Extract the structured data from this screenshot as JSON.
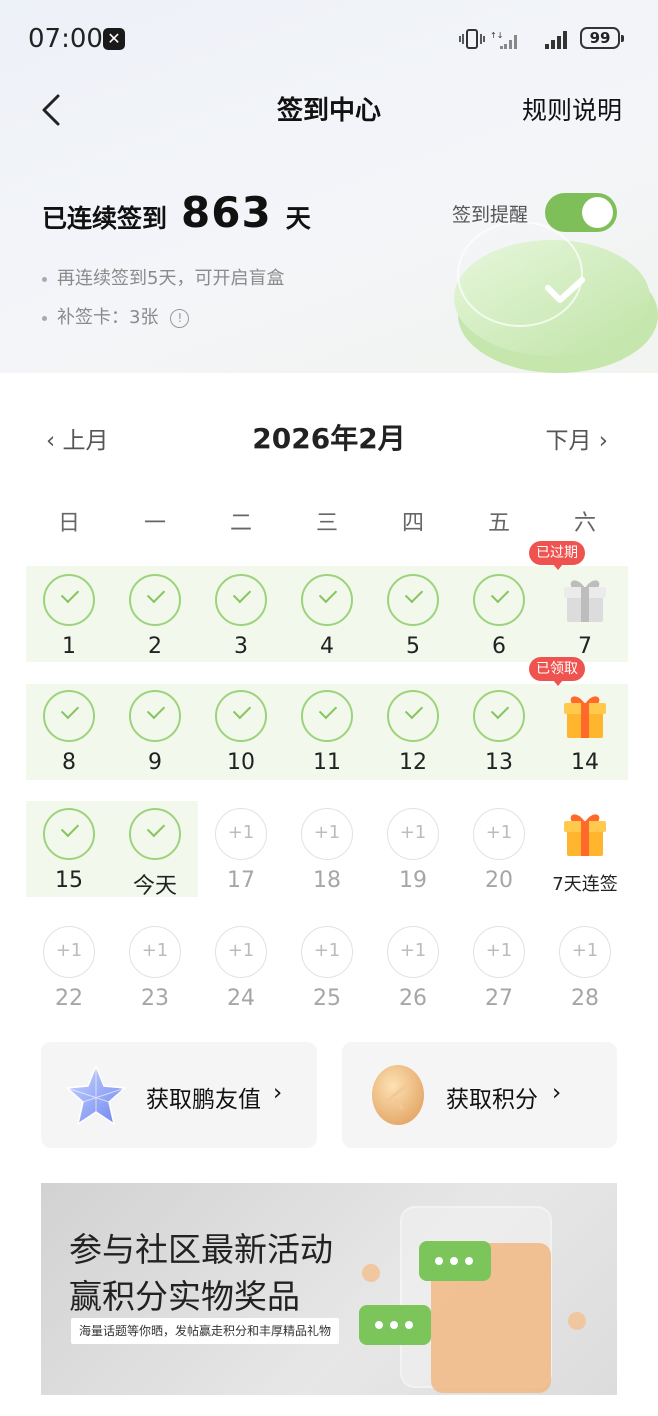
{
  "status_bar": {
    "time": "07:00",
    "app_badge_icon": "x-app-icon",
    "battery": "99"
  },
  "nav": {
    "title": "签到中心",
    "rules": "规则说明"
  },
  "summary": {
    "streak_prefix": "已连续签到",
    "streak_days": "863",
    "streak_suffix": "天",
    "reminder_label": "签到提醒",
    "reminder_on": true,
    "tips": [
      "再连续签到5天，可开启盲盒",
      "补签卡：3张"
    ]
  },
  "calendar": {
    "prev": "上月",
    "month": "2026年2月",
    "next": "下月",
    "weekdays": [
      "日",
      "一",
      "二",
      "三",
      "四",
      "五",
      "六"
    ],
    "weeks": [
      [
        {
          "label": "1",
          "state": "done"
        },
        {
          "label": "2",
          "state": "done"
        },
        {
          "label": "3",
          "state": "done"
        },
        {
          "label": "4",
          "state": "done"
        },
        {
          "label": "5",
          "state": "done"
        },
        {
          "label": "6",
          "state": "done"
        },
        {
          "label": "7",
          "state": "gift-expired",
          "badge": "已过期"
        }
      ],
      [
        {
          "label": "8",
          "state": "done"
        },
        {
          "label": "9",
          "state": "done"
        },
        {
          "label": "10",
          "state": "done"
        },
        {
          "label": "11",
          "state": "done"
        },
        {
          "label": "12",
          "state": "done"
        },
        {
          "label": "13",
          "state": "done"
        },
        {
          "label": "14",
          "state": "gift",
          "badge": "已领取"
        }
      ],
      [
        {
          "label": "15",
          "state": "done"
        },
        {
          "label": "今天",
          "state": "done"
        },
        {
          "label": "17",
          "state": "future",
          "plus": "+1"
        },
        {
          "label": "18",
          "state": "future",
          "plus": "+1"
        },
        {
          "label": "19",
          "state": "future",
          "plus": "+1"
        },
        {
          "label": "20",
          "state": "future",
          "plus": "+1"
        },
        {
          "label": "7天连签",
          "state": "gift"
        }
      ],
      [
        {
          "label": "22",
          "state": "future",
          "plus": "+1"
        },
        {
          "label": "23",
          "state": "future",
          "plus": "+1"
        },
        {
          "label": "24",
          "state": "future",
          "plus": "+1"
        },
        {
          "label": "25",
          "state": "future",
          "plus": "+1"
        },
        {
          "label": "26",
          "state": "future",
          "plus": "+1"
        },
        {
          "label": "27",
          "state": "future",
          "plus": "+1"
        },
        {
          "label": "28",
          "state": "future",
          "plus": "+1"
        }
      ]
    ]
  },
  "actions": {
    "friend_value": "获取鹏友值",
    "points": "获取积分"
  },
  "banner": {
    "line1": "参与社区最新活动",
    "line2": "赢积分实物奖品",
    "sub": "海量话题等你晒，发帖赢走积分和丰厚精品礼物"
  },
  "colors": {
    "accent_green": "#7fbf59",
    "badge_red": "#ef5350",
    "check_green": "#9cd37c"
  }
}
